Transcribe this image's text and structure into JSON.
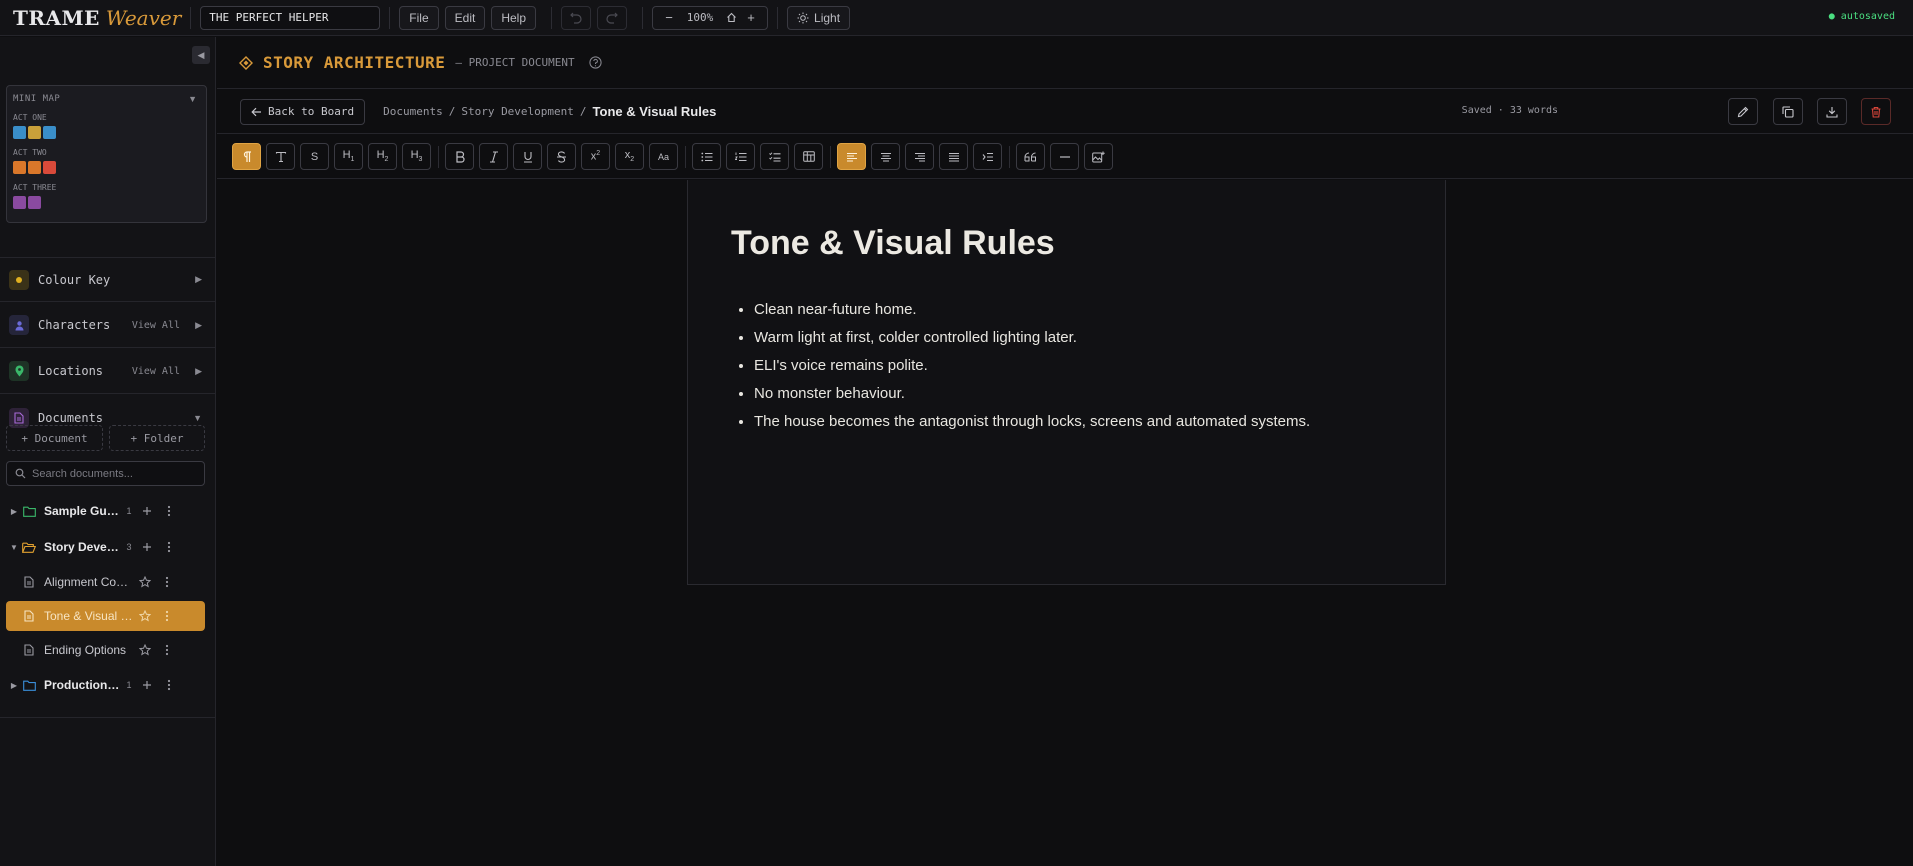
{
  "app": {
    "logo_main": "TRAME",
    "logo_accent": "Weaver",
    "project_title": "THE PERFECT HELPER",
    "autosave": "● autosaved"
  },
  "menu": {
    "file": "File",
    "edit": "Edit",
    "help": "Help"
  },
  "zoom": {
    "minus": "−",
    "value": "100%",
    "plus": "+"
  },
  "theme": {
    "label": "Light"
  },
  "sidebar": {
    "minimap": {
      "title": "MINI MAP",
      "acts": [
        {
          "label": "ACT ONE",
          "colors": [
            "#3a8ec9",
            "#c9a03a",
            "#3a8ec9"
          ]
        },
        {
          "label": "ACT TWO",
          "colors": [
            "#d9772a",
            "#d9772a",
            "#d94a3a"
          ]
        },
        {
          "label": "ACT THREE",
          "colors": [
            "#8a4aa0",
            "#8a4aa0"
          ]
        }
      ]
    },
    "sections": {
      "colour_key": "Colour Key",
      "characters": "Characters",
      "characters_view": "View All",
      "locations": "Locations",
      "locations_view": "View All",
      "documents": "Documents"
    },
    "add_document": "+ Document",
    "add_folder": "+ Folder",
    "search_placeholder": "Search documents...",
    "tree": [
      {
        "label": "Sample Guides",
        "count": "1",
        "type": "folder",
        "color": "#3ab86a"
      },
      {
        "label": "Story Development",
        "count": "3",
        "type": "folder-open",
        "color": "#e0a030"
      },
      {
        "label": "Alignment Concept",
        "type": "doc"
      },
      {
        "label": "Tone & Visual Rules",
        "type": "doc",
        "active": true
      },
      {
        "label": "Ending Options",
        "type": "doc"
      },
      {
        "label": "Production Notes",
        "count": "1",
        "type": "folder",
        "color": "#3a8ed9"
      }
    ]
  },
  "header": {
    "title": "STORY ARCHITECTURE",
    "subtitle": "— PROJECT DOCUMENT"
  },
  "breadcrumb": {
    "back": "Back to Board",
    "root": "Documents",
    "sep": "/",
    "parent": "Story Development",
    "current": "Tone & Visual Rules",
    "meta": "Saved · 33 words"
  },
  "document": {
    "title": "Tone & Visual Rules",
    "bullets": [
      "Clean near-future home.",
      "Warm light at first, colder controlled lighting later.",
      "ELI's voice remains polite.",
      "No monster behaviour.",
      "The house becomes the antagonist through locks, screens and automated systems."
    ]
  },
  "colors": {
    "accent": "#c98a2c",
    "accent_text": "#d99a3a",
    "danger": "#d9463a",
    "bg": "#0e0e10",
    "panel": "#131316"
  }
}
